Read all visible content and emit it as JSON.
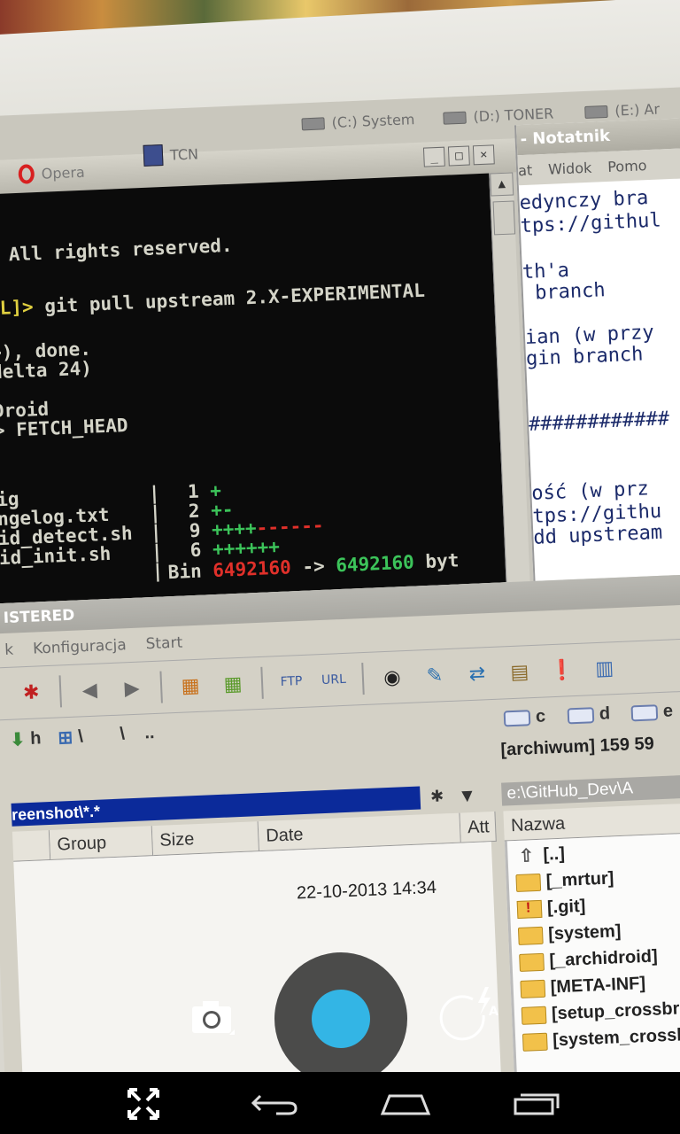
{
  "taskbar": {
    "opera_label": "Opera",
    "tc_label": "TCN",
    "drive_c": "(C:) System",
    "drive_d": "(D:) TONER",
    "drive_e": "(E:) Ar"
  },
  "terminal": {
    "lines": [
      ". All rights reserved.",
      "git pull upstream 2.X-EXPERIMENTAL",
      ">), done.",
      "delta 24)",
      "Droid",
      "> FETCH_HEAD",
      "ig",
      "ngelog.txt",
      "id_detect.sh",
      "id_init.sh"
    ],
    "prompt_tag": "AL]>",
    "stats": [
      {
        "num": "1",
        "marks": "+"
      },
      {
        "num": "2",
        "marks": "+-"
      },
      {
        "num": "9",
        "marks": "++++"
      },
      {
        "num": "6",
        "marks": "++++++"
      }
    ],
    "bin_label": "Bin",
    "bin_from": "6492160",
    "bin_arrow": "->",
    "bin_to": "6492160",
    "bin_unit": "byt"
  },
  "notepad": {
    "title": "- Notatnik",
    "menu": [
      "at",
      "Widok",
      "Pomo"
    ],
    "lines": [
      "edynczy bra",
      "tps://githul",
      "",
      "th'a",
      " branch",
      "",
      "ian (w przy",
      "gin branch",
      "",
      "",
      "############",
      "",
      "",
      "ość (w prz",
      "tps://githu",
      "dd upstream"
    ]
  },
  "tc": {
    "title": "ISTERED",
    "menu": [
      "k",
      "Konfiguracja",
      "Start"
    ],
    "drive_h": "h",
    "path_sep": "\\",
    "path_sep2": "\\",
    "path_dots": "..",
    "drive_c": "c",
    "drive_d": "d",
    "drive_e": "e",
    "archive_info": "[archiwum]  159 59",
    "left_path": "reenshot\\*.*",
    "right_path": "e:\\GitHub_Dev\\A",
    "columns": [
      "Group",
      "Size",
      "Date",
      "Att"
    ],
    "right_column": "Nazwa",
    "left_date": "22-10-2013 14:34",
    "right_files": [
      "[..]",
      "[_mrtur]",
      "[.git]",
      "[system]",
      "[_archidroid]",
      "[META-INF]",
      "[setup_crossbre",
      "[system_crossb"
    ]
  },
  "camera": {
    "shutter_color": "#33b5e5",
    "flash_mode": "A"
  },
  "navbar": {
    "icons": [
      "fullscreen-icon",
      "back-icon",
      "home-icon",
      "recents-icon"
    ]
  }
}
